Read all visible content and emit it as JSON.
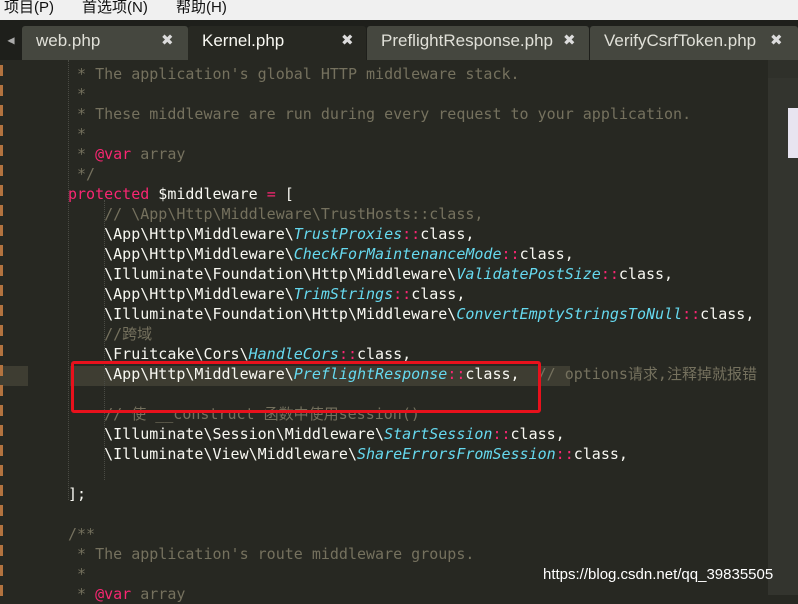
{
  "menubar": {
    "items": [
      "项目(P)",
      "首选项(N)",
      "帮助(H)"
    ]
  },
  "tabs": [
    {
      "label": "web.php",
      "active": false
    },
    {
      "label": "Kernel.php",
      "active": true
    },
    {
      "label": "PreflightResponse.php",
      "active": false
    },
    {
      "label": "VerifyCsrfToken.php",
      "active": false
    }
  ],
  "tab_close_glyph": "✖",
  "editor": {
    "lines": [
      {
        "segments": [
          {
            "cls": "c",
            "text": " * The application's global HTTP middleware stack."
          }
        ]
      },
      {
        "segments": [
          {
            "cls": "c",
            "text": " *"
          }
        ]
      },
      {
        "segments": [
          {
            "cls": "c",
            "text": " * These middleware are run during every request to your application."
          }
        ]
      },
      {
        "segments": [
          {
            "cls": "c",
            "text": " *"
          }
        ]
      },
      {
        "segments": [
          {
            "cls": "c",
            "text": " * "
          },
          {
            "cls": "k",
            "text": "@var"
          },
          {
            "cls": "c",
            "text": " array"
          }
        ]
      },
      {
        "segments": [
          {
            "cls": "c",
            "text": " */"
          }
        ]
      },
      {
        "segments": [
          {
            "cls": "k",
            "text": "protected"
          },
          {
            "cls": "t",
            "text": " $middleware "
          },
          {
            "cls": "k",
            "text": "="
          },
          {
            "cls": "t",
            "text": " ["
          }
        ]
      },
      {
        "segments": [
          {
            "cls": "c",
            "text": "    // \\App\\Http\\Middleware\\TrustHosts::class,"
          }
        ]
      },
      {
        "segments": [
          {
            "cls": "t",
            "text": "    \\App\\Http\\Middleware\\"
          },
          {
            "cls": "i",
            "text": "TrustProxies"
          },
          {
            "cls": "k",
            "text": "::"
          },
          {
            "cls": "t",
            "text": "class,"
          }
        ]
      },
      {
        "segments": [
          {
            "cls": "t",
            "text": "    \\App\\Http\\Middleware\\"
          },
          {
            "cls": "i",
            "text": "CheckForMaintenanceMode"
          },
          {
            "cls": "k",
            "text": "::"
          },
          {
            "cls": "t",
            "text": "class,"
          }
        ]
      },
      {
        "segments": [
          {
            "cls": "t",
            "text": "    \\Illuminate\\Foundation\\Http\\Middleware\\"
          },
          {
            "cls": "i",
            "text": "ValidatePostSize"
          },
          {
            "cls": "k",
            "text": "::"
          },
          {
            "cls": "t",
            "text": "class,"
          }
        ]
      },
      {
        "segments": [
          {
            "cls": "t",
            "text": "    \\App\\Http\\Middleware\\"
          },
          {
            "cls": "i",
            "text": "TrimStrings"
          },
          {
            "cls": "k",
            "text": "::"
          },
          {
            "cls": "t",
            "text": "class,"
          }
        ]
      },
      {
        "segments": [
          {
            "cls": "t",
            "text": "    \\Illuminate\\Foundation\\Http\\Middleware\\"
          },
          {
            "cls": "i",
            "text": "ConvertEmptyStringsToNull"
          },
          {
            "cls": "k",
            "text": "::"
          },
          {
            "cls": "t",
            "text": "class,"
          }
        ]
      },
      {
        "segments": [
          {
            "cls": "c",
            "text": "    //跨域"
          }
        ]
      },
      {
        "segments": [
          {
            "cls": "t",
            "text": "    \\Fruitcake\\Cors\\"
          },
          {
            "cls": "i",
            "text": "HandleCors"
          },
          {
            "cls": "k",
            "text": "::"
          },
          {
            "cls": "t",
            "text": "class,"
          }
        ]
      },
      {
        "segments": [
          {
            "cls": "t",
            "text": "    \\App\\Http\\Middleware\\"
          },
          {
            "cls": "i",
            "text": "PreflightResponse"
          },
          {
            "cls": "k",
            "text": "::"
          },
          {
            "cls": "t",
            "text": "class,"
          },
          {
            "cls": "c",
            "text": "  // options请求,注释掉就报错"
          }
        ]
      },
      {
        "segments": [
          {
            "cls": "t",
            "text": ""
          }
        ]
      },
      {
        "segments": [
          {
            "cls": "c",
            "text": "    // 使 __construct 函数中使用session()"
          }
        ]
      },
      {
        "segments": [
          {
            "cls": "t",
            "text": "    \\Illuminate\\Session\\Middleware\\"
          },
          {
            "cls": "i",
            "text": "StartSession"
          },
          {
            "cls": "k",
            "text": "::"
          },
          {
            "cls": "t",
            "text": "class,"
          }
        ]
      },
      {
        "segments": [
          {
            "cls": "t",
            "text": "    \\Illuminate\\View\\Middleware\\"
          },
          {
            "cls": "i",
            "text": "ShareErrorsFromSession"
          },
          {
            "cls": "k",
            "text": "::"
          },
          {
            "cls": "t",
            "text": "class,"
          }
        ]
      },
      {
        "segments": [
          {
            "cls": "t",
            "text": ""
          }
        ]
      },
      {
        "segments": [
          {
            "cls": "t",
            "text": "];"
          }
        ]
      },
      {
        "segments": [
          {
            "cls": "t",
            "text": ""
          }
        ]
      },
      {
        "segments": [
          {
            "cls": "c",
            "text": "/**"
          }
        ]
      },
      {
        "segments": [
          {
            "cls": "c",
            "text": " * The application's route middleware groups."
          }
        ]
      },
      {
        "segments": [
          {
            "cls": "c",
            "text": " *"
          }
        ]
      },
      {
        "segments": [
          {
            "cls": "c",
            "text": " * "
          },
          {
            "cls": "k",
            "text": "@var"
          },
          {
            "cls": "c",
            "text": " array"
          }
        ]
      }
    ]
  },
  "watermark": "https://blog.csdn.net/qq_39835505",
  "colors": {
    "editor_bg": "#272822",
    "comment": "#75715e",
    "keyword": "#f92672",
    "class_name": "#66d9ef",
    "plain": "#f8f8f2",
    "annotation_box": "#e8111c"
  }
}
